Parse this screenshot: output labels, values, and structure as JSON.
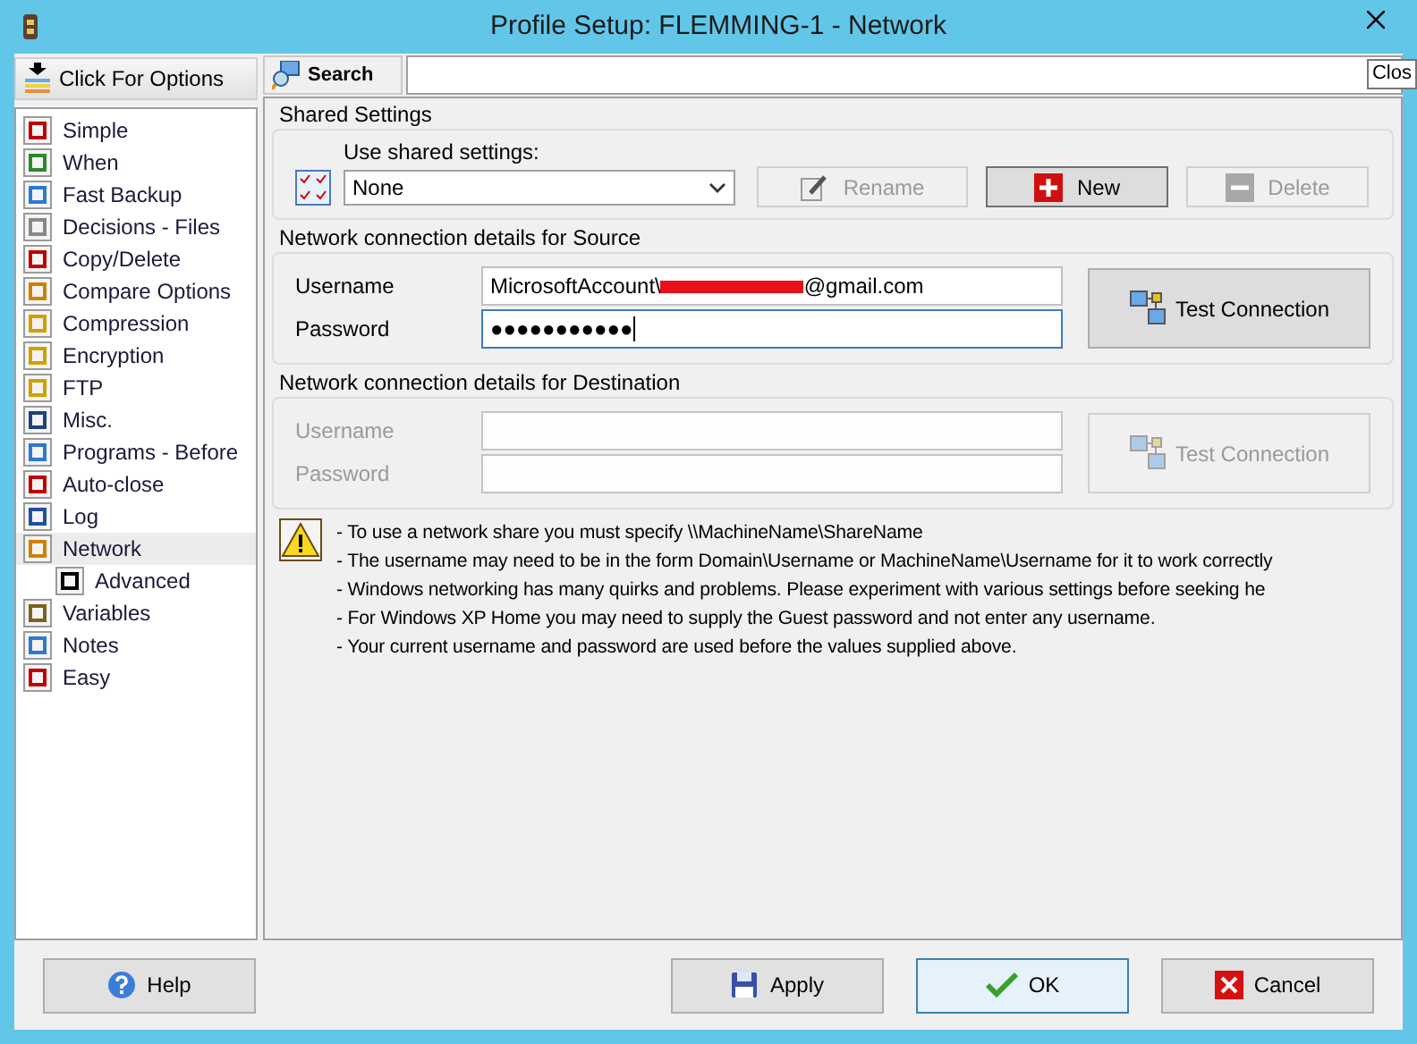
{
  "window": {
    "title": "Profile Setup: FLEMMING-1 - Network",
    "close_tooltip": "Clos"
  },
  "options_button": "Click For Options",
  "sidebar": {
    "items": [
      {
        "label": "Simple",
        "selected": false
      },
      {
        "label": "When",
        "selected": false
      },
      {
        "label": "Fast Backup",
        "selected": false
      },
      {
        "label": "Decisions - Files",
        "selected": false
      },
      {
        "label": "Copy/Delete",
        "selected": false
      },
      {
        "label": "Compare Options",
        "selected": false
      },
      {
        "label": "Compression",
        "selected": false
      },
      {
        "label": "Encryption",
        "selected": false
      },
      {
        "label": "FTP",
        "selected": false
      },
      {
        "label": "Misc.",
        "selected": false
      },
      {
        "label": "Programs - Before",
        "selected": false
      },
      {
        "label": "Auto-close",
        "selected": false
      },
      {
        "label": "Log",
        "selected": false
      },
      {
        "label": "Network",
        "selected": true,
        "children": [
          {
            "label": "Advanced",
            "selected": false
          }
        ]
      },
      {
        "label": "Variables",
        "selected": false
      },
      {
        "label": "Notes",
        "selected": false
      },
      {
        "label": "Easy",
        "selected": false
      }
    ]
  },
  "search": {
    "button": "Search"
  },
  "shared_settings": {
    "title": "Shared Settings",
    "label": "Use shared settings:",
    "value": "None",
    "buttons": [
      {
        "label": "Rename",
        "kind": "rename",
        "disabled": true
      },
      {
        "label": "New",
        "kind": "new",
        "disabled": false
      },
      {
        "label": "Delete",
        "kind": "delete",
        "disabled": true
      }
    ]
  },
  "source": {
    "title": "Network connection details for Source",
    "disabled": false,
    "test_button": "Test Connection",
    "fields": [
      {
        "label": "Username",
        "value_parts": [
          "MicrosoftAccount\\",
          "@gmail.com"
        ],
        "redacted": true,
        "focused": false
      },
      {
        "label": "Password",
        "value_parts": [
          "●●●●●●●●●●●"
        ],
        "focused": true
      }
    ]
  },
  "destination": {
    "title": "Network connection details for Destination",
    "disabled": true,
    "test_button": "Test Connection",
    "fields": [
      {
        "label": "Username",
        "focused": false
      },
      {
        "label": "Password",
        "focused": false
      }
    ]
  },
  "notes": [
    "- To use a network share you must specify \\\\MachineName\\ShareName",
    "- The username may need to be in the form Domain\\Username or MachineName\\Username for it to work correctly",
    "- Windows networking has many quirks and problems. Please experiment with various settings before seeking he",
    "- For Windows XP Home you may need to supply the Guest password and not enter any username.",
    "- Your current username and password are used before the values supplied above."
  ],
  "buttons": [
    {
      "label": "Help",
      "kind": "help",
      "default": false
    },
    {
      "label": "Apply",
      "kind": "apply",
      "default": false
    },
    {
      "label": "OK",
      "kind": "ok",
      "default": true
    },
    {
      "label": "Cancel",
      "kind": "cancel",
      "default": false
    }
  ]
}
